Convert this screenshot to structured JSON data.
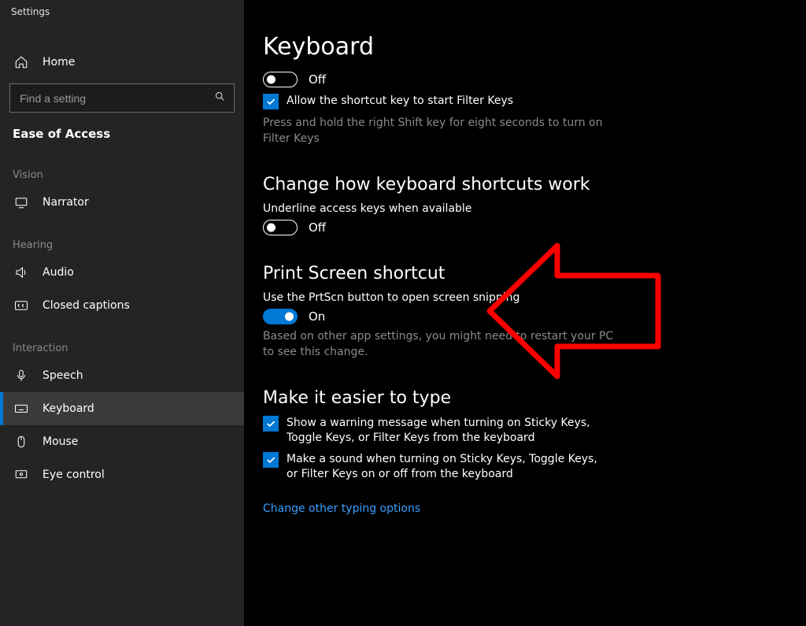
{
  "app": {
    "title": "Settings"
  },
  "sidebar": {
    "home_label": "Home",
    "search_placeholder": "Find a setting",
    "category": "Ease of Access",
    "sections": [
      {
        "label": "Vision",
        "items": [
          {
            "icon": "narrator-icon",
            "label": "Narrator"
          }
        ]
      },
      {
        "label": "Hearing",
        "items": [
          {
            "icon": "audio-icon",
            "label": "Audio"
          },
          {
            "icon": "closed-captions-icon",
            "label": "Closed captions"
          }
        ]
      },
      {
        "label": "Interaction",
        "items": [
          {
            "icon": "speech-icon",
            "label": "Speech"
          },
          {
            "icon": "keyboard-icon",
            "label": "Keyboard",
            "selected": true
          },
          {
            "icon": "mouse-icon",
            "label": "Mouse"
          },
          {
            "icon": "eye-control-icon",
            "label": "Eye control"
          }
        ]
      }
    ]
  },
  "main": {
    "title": "Keyboard",
    "top_toggle": {
      "state": "off",
      "label": "Off"
    },
    "filter_keys_checkbox": {
      "checked": true,
      "label": "Allow the shortcut key to start Filter Keys"
    },
    "filter_keys_help": "Press and hold the right Shift key for eight seconds to turn on Filter Keys",
    "shortcuts_section": {
      "title": "Change how keyboard shortcuts work",
      "underline_label": "Underline access keys when available",
      "underline_toggle": {
        "state": "off",
        "label": "Off"
      }
    },
    "prtscn_section": {
      "title": "Print Screen shortcut",
      "desc": "Use the PrtScn button to open screen snipping",
      "toggle": {
        "state": "on",
        "label": "On"
      },
      "help": "Based on other app settings, you might need to restart your PC to see this change."
    },
    "easier_section": {
      "title": "Make it easier to type",
      "check1": "Show a warning message when turning on Sticky Keys, Toggle Keys, or Filter Keys from the keyboard",
      "check2": "Make a sound when turning on Sticky Keys, Toggle Keys, or Filter Keys on or off from the keyboard",
      "link": "Change other typing options"
    }
  }
}
